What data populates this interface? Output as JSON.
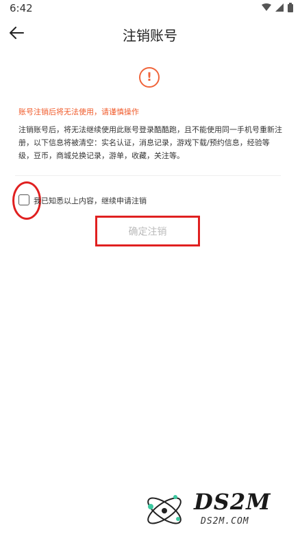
{
  "status_bar": {
    "time": "6:42",
    "icons": [
      "wifi-icon",
      "signal-icon",
      "battery-icon"
    ]
  },
  "header": {
    "title": "注销账号",
    "back_icon": "arrow-left-icon"
  },
  "content": {
    "alert_icon": "!",
    "warning": "账号注销后将无法使用，请谨慎操作",
    "description_line1": "注销账号后，将无法继续使用此账号登录酷酷跑，且不能使用同一手机号重新注",
    "description_line2": "册，以下信息将被清空：实名认证，消息记录，游戏下载/预约信息，经验等",
    "description_line3": "级，豆币，商城兑换记录，游单，收藏，关注等。"
  },
  "agreement": {
    "checked": false,
    "label": "我已知悉以上内容，继续申请注销"
  },
  "actions": {
    "confirm_label": "确定注销"
  },
  "watermark": {
    "logo_text": "DS2M",
    "domain_text": "DS2M.COM"
  },
  "colors": {
    "accent": "#f0643a",
    "highlight": "#e02020",
    "disabled_text": "#bbbbbb"
  }
}
